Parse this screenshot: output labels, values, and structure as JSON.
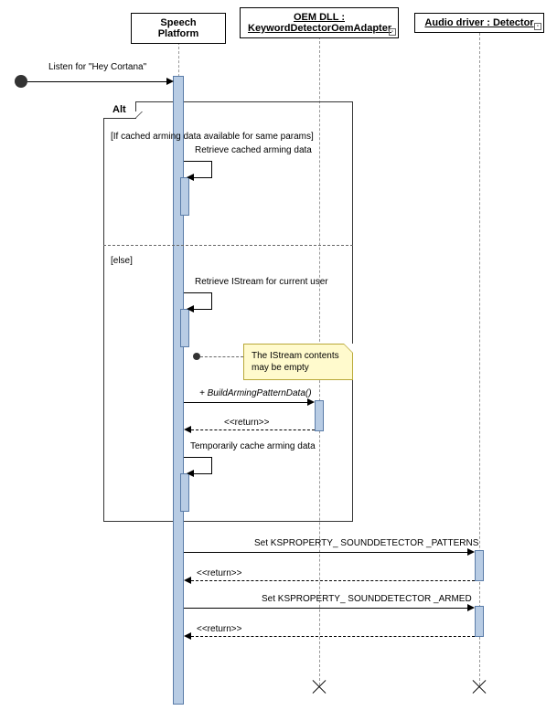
{
  "participants": {
    "p1": {
      "name": "Speech Platform"
    },
    "p2": {
      "line1": "OEM DLL :",
      "line2": "KeywordDetectorOemAdapter"
    },
    "p3": {
      "name": "Audio driver : Detector"
    }
  },
  "trigger": "Listen for \"Hey Cortana\"",
  "alt": {
    "label": "Alt",
    "guard_if": "[If cached arming data available for same params]",
    "guard_else": "[else]",
    "msg_cached": "Retrieve cached arming data",
    "msg_istream": "Retrieve IStream for current user",
    "msg_build": "+ BuildArmingPatternData()",
    "msg_return": "<<return>>",
    "msg_cache": "Temporarily cache arming data"
  },
  "note": "The IStream contents may be empty",
  "msgs": {
    "set_patterns": "Set KSPROPERTY_ SOUNDDETECTOR _PATTERNS",
    "set_armed": "Set KSPROPERTY_ SOUNDDETECTOR _ARMED",
    "ret": "<<return>>"
  }
}
